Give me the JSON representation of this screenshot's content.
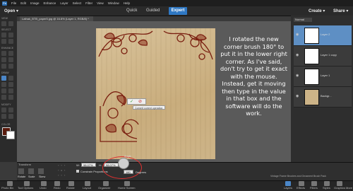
{
  "menubar": [
    "File",
    "Edit",
    "Image",
    "Enhance",
    "Layer",
    "Select",
    "Filter",
    "View",
    "Window",
    "Help"
  ],
  "header": {
    "open": "Open",
    "modes": [
      "Quick",
      "Guided",
      "Expert"
    ],
    "create": "Create",
    "share": "Share"
  },
  "document": {
    "tab": "Lathak_BTB_paper5.jpg @ 16.8% (Layer 1, RGB/8) *"
  },
  "annotation": "I rotated the new corner brush 180° to put it in the lower right corner. As I've said, don't try to get it exact with the mouse. Instead, get it moving then type in the value in that box and the software will do the work.",
  "commit_tip": "Commit current operation",
  "layers": [
    {
      "name": "Layer 2",
      "selected": true
    },
    {
      "name": "Layer 1 copy",
      "selected": false
    },
    {
      "name": "Layer 1",
      "selected": false
    },
    {
      "name": "Backgr...",
      "selected": false
    }
  ],
  "toolbar_sections": [
    "VIEW",
    "SELECT",
    "ENHANCE",
    "DRAW",
    "MODIFY",
    "COLOR"
  ],
  "tool_options": {
    "section": "Transform",
    "buttons": [
      "Rotate",
      "Scale",
      "Skew"
    ],
    "w": "98.07%",
    "h": "98.07%",
    "constrain": "Constrain Proportions",
    "angle_label": "Angle",
    "angle_value": "180",
    "degrees": "Degrees",
    "status": "Vintage Frame Brushes and Ornament Brush Pack"
  },
  "statusbar": [
    "Photo Bin",
    "Tool Options",
    "Undo",
    "Redo",
    "Rotate",
    "Layout",
    "Organizer",
    "Home Screen"
  ],
  "statusbar_right": [
    "Layers",
    "Effects",
    "Filters",
    "Styles",
    "Graphics",
    "More"
  ],
  "blend_mode": "Normal",
  "colors": {
    "accent": "#2f78c4",
    "annotation_circle": "#e03030",
    "ornament": "#7a1f10"
  }
}
